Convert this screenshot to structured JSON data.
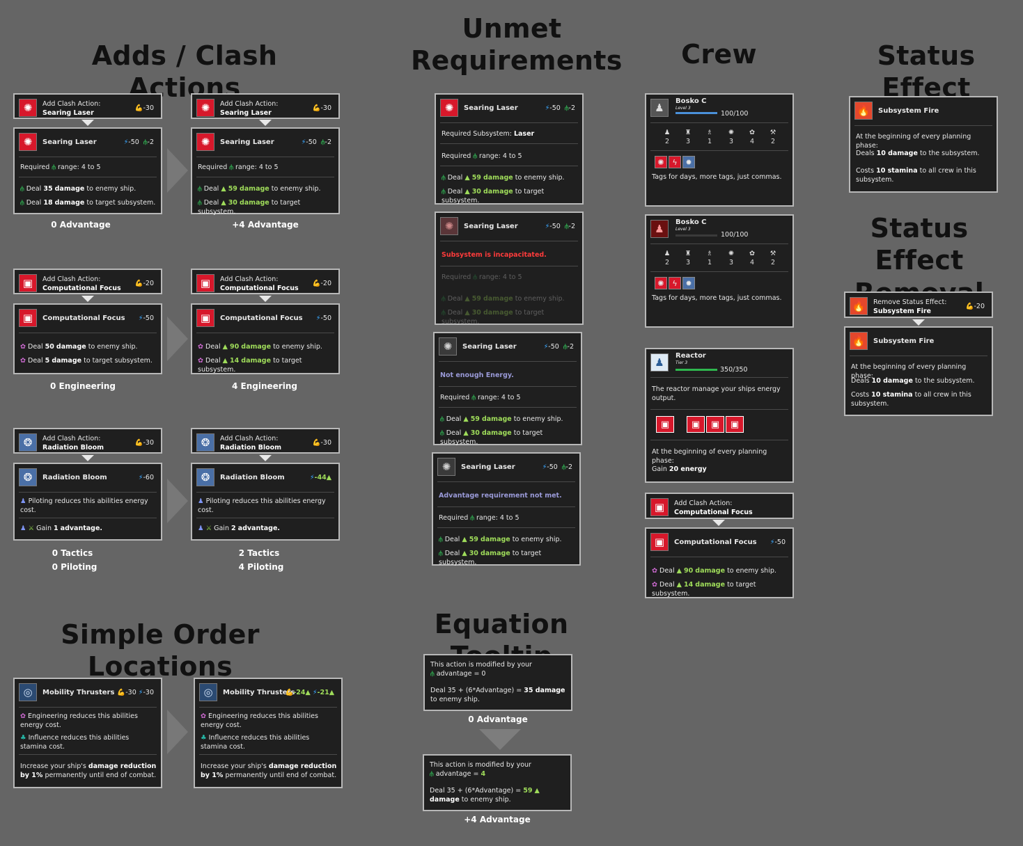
{
  "headings": {
    "clash": "Adds / Clash Actions",
    "unmet1": "Unmet",
    "unmet2": "Requirements",
    "crew": "Crew",
    "status": "Status Effect",
    "removal1": "Status Effect",
    "removal2": "Removal",
    "simple": "Simple Order Locations",
    "equation": "Equation Tooltip"
  },
  "icons": {
    "laser": "✺",
    "cpu": "▣",
    "bloom": "❂",
    "thrusters": "◎",
    "fire": "🔥",
    "reactor": "♟",
    "stamina": "💪",
    "energy": "⚡",
    "range": "⫛",
    "gear": "✿",
    "bell": "♟",
    "crew": "♟"
  },
  "common": {
    "add_clash": "Add Clash Action:",
    "searing": "Searing Laser",
    "comp": "Computational Focus",
    "bloom": "Radiation Bloom",
    "required": "Required",
    "range": "range: 4 to 5",
    "deal": "Deal",
    "to_enemy": "to enemy ship.",
    "to_target": "to target subsystem.",
    "damage": "damage",
    "cost30": "-30",
    "cost20": "-20",
    "cost50": "-50",
    "cost2": "-2",
    "cost60": "-60",
    "cost44": "-44",
    "dmg35": "35",
    "dmg18": "18",
    "dmg59": "59",
    "dmg30": "30",
    "dmg50": "50",
    "dmg5": "5",
    "dmg90": "90",
    "dmg14": "14",
    "piloting_reduce": "Piloting reduces this abilities energy cost.",
    "gain": "Gain",
    "advantage_word": "advantage.",
    "gain1": "1",
    "gain2": "2",
    "up": "▲"
  },
  "labels": {
    "adv0": "0 Advantage",
    "adv4": "+4 Advantage",
    "eng0": "0 Engineering",
    "eng4": "4 Engineering",
    "tac0": "0 Tactics",
    "pil0": "0 Piloting",
    "tac2": "2 Tactics",
    "pil4": "4 Piloting",
    "eq0": "0 Advantage",
    "eq4": "+4 Advantage"
  },
  "unmet": {
    "req_sub": "Required Subsystem:",
    "laser": "Laser",
    "incap": "Subsystem is incapacitated.",
    "energy": "Not enough Energy.",
    "adv": "Advantage requirement not met."
  },
  "crew": {
    "name": "Bosko C",
    "level": "Level 3",
    "hp": "100/100",
    "stats": [
      "2",
      "3",
      "1",
      "3",
      "4",
      "2"
    ],
    "stat_icons": [
      "♟",
      "♜",
      "♗",
      "✺",
      "✿",
      "⚒"
    ],
    "tags_text": "Tags for days, more tags, just commas.",
    "reactor": "Reactor",
    "tier": "Tier 3",
    "reactor_hp": "350/350",
    "reactor_desc": "The reactor manage your ships energy output.",
    "reactor_begin": "At the beginning of every planning phase:",
    "gain_energy_pre": "Gain",
    "gain_energy": "20 energy"
  },
  "status": {
    "title": "Subsystem Fire",
    "begin": "At the beginning of every planning phase:",
    "deals_pre": "Deals",
    "deals_b": "10 damage",
    "deals_post": "to the subsystem.",
    "costs_pre": "Costs",
    "costs_b": "10 stamina",
    "costs_post": "to all crew in this subsystem.",
    "remove": "Remove Status Effect:",
    "cost": "-20"
  },
  "simple": {
    "title": "Mobility Thrusters",
    "c30": "-30",
    "c24": "-24",
    "c21": "-21",
    "eng_reduce": "Engineering reduces this abilities energy cost.",
    "inf_reduce": "Influence reduces this abilities stamina cost.",
    "inc_pre": "Increase your ship's",
    "dr": "damage reduction",
    "by1": "by 1%",
    "inc_post": "permanently until end of combat."
  },
  "equation": {
    "mod": "This action is modified by your",
    "adv0": "advantage = 0",
    "adv4_pre": "advantage =",
    "adv4_val": "4",
    "deal_pre": "Deal 35 + (6*Advantage) =",
    "r35": "35 damage",
    "r59": "59",
    "dmg": "damage",
    "to": "to",
    "enemy": "enemy ship."
  }
}
